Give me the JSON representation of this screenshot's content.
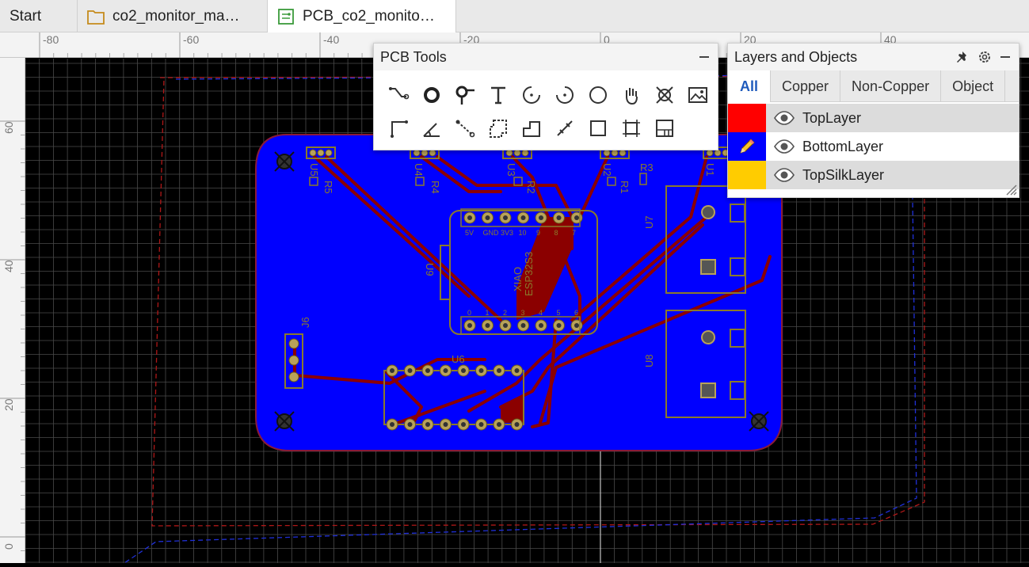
{
  "tabs": [
    {
      "label": "Start",
      "icon": "none",
      "active": false
    },
    {
      "label": "co2_monitor_ma…",
      "icon": "folder-icon",
      "active": false
    },
    {
      "label": "PCB_co2_monito…",
      "icon": "pcb-icon",
      "active": true
    }
  ],
  "ruler": {
    "top_labels": [
      "-80",
      "-60",
      "-40",
      "-20",
      "0",
      "20",
      "40"
    ],
    "left_labels": [
      "60",
      "40",
      "20",
      "0"
    ]
  },
  "pcb_tools": {
    "title": "PCB Tools",
    "tools": [
      "track-icon",
      "via-icon",
      "probe-icon",
      "text-icon",
      "arc-center-icon",
      "arc-3pt-icon",
      "circle-icon",
      "pan-icon",
      "cross-icon",
      "image-icon",
      "angle-track-icon",
      "angle-icon",
      "dimension-icon",
      "region-icon",
      "step-icon",
      "measure-icon",
      "rectangle-icon",
      "group-icon",
      "panel-icon"
    ]
  },
  "layers_panel": {
    "title": "Layers and Objects",
    "tabs": [
      "All",
      "Copper",
      "Non-Copper",
      "Object"
    ],
    "active_tab": "All",
    "layers": [
      {
        "name": "TopLayer",
        "color": "#ff0000",
        "active": false
      },
      {
        "name": "BottomLayer",
        "color": "#0000ff",
        "active": true
      },
      {
        "name": "TopSilkLayer",
        "color": "#ffcc00",
        "active": false
      }
    ]
  },
  "board": {
    "refdes": [
      "U5",
      "U4",
      "U3",
      "U2",
      "U1",
      "R5",
      "R4",
      "R2",
      "R1",
      "R3",
      "U9",
      "U7",
      "U8",
      "J6",
      "U6"
    ],
    "module_text": [
      "XIAO",
      "ESP32S3"
    ],
    "top_pins": [
      "5V",
      "GND",
      "3V3",
      "10",
      "9",
      "8",
      "7"
    ],
    "bottom_pins": [
      "0",
      "1",
      "2",
      "3",
      "4",
      "5",
      "6"
    ]
  },
  "colors": {
    "board_fill": "#0000ff",
    "copper_top": "#8b0000",
    "silk": "#8a7a2c",
    "grid": "#4a4a4a"
  }
}
